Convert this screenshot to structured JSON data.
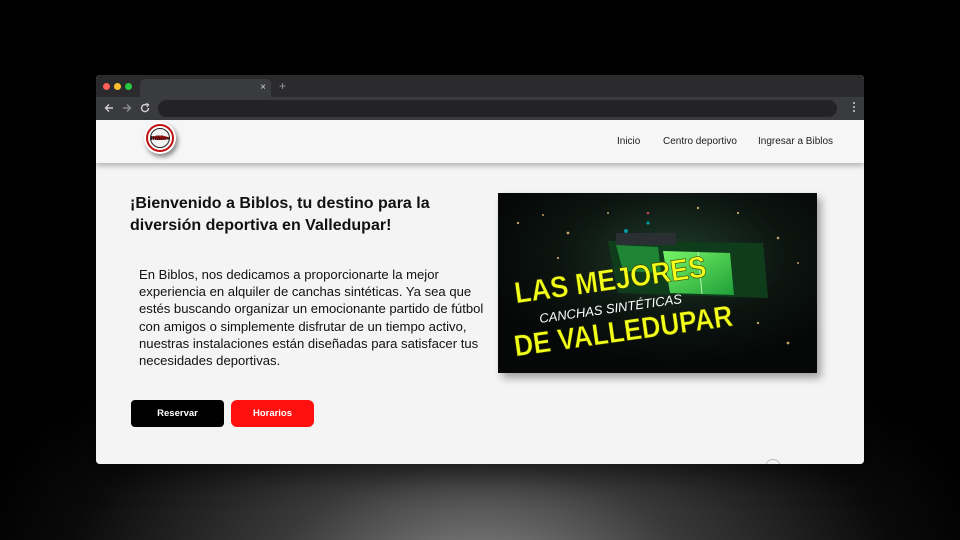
{
  "browser": {
    "tab_title": "",
    "tab_close": "×",
    "new_tab": "+",
    "address": "",
    "colors": {
      "close": "#ff5f56",
      "minimize": "#ffbd2e",
      "zoom": "#27c93f"
    }
  },
  "site": {
    "logo_text": "Biblos",
    "nav": {
      "inicio": "Inicio",
      "centro": "Centro deportivo",
      "ingresar": "Ingresar a Biblos"
    },
    "hero_title": "¡Bienvenido a Biblos, tu destino para la diversión deportiva en Valledupar!",
    "description": "En Biblos, nos dedicamos a proporcionarte la mejor experiencia en alquiler de canchas sintéticas. Ya sea que estés buscando organizar un emocionante partido de fútbol con amigos o simplemente disfrutar de un tiempo activo, nuestras instalaciones están diseñadas para satisfacer tus necesidades deportivas.",
    "buttons": {
      "reservar": "Reservar",
      "horarios": "Horarios"
    },
    "banner": {
      "line1": "LAS MEJORES",
      "line2": "CANCHAS SINTÉTICAS",
      "line3": "DE VALLEDUPAR"
    },
    "accent": "#ff1010"
  }
}
